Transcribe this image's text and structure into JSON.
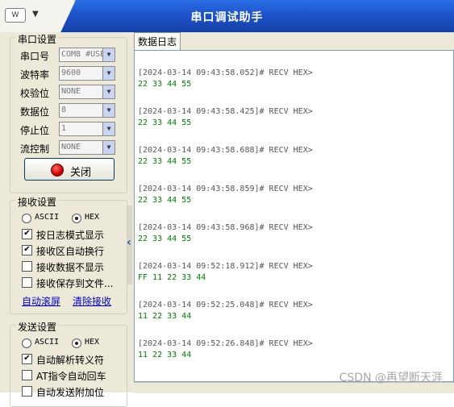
{
  "app": {
    "title": "串口调试助手",
    "logo_text": "W",
    "menu_caret": "▼"
  },
  "serial": {
    "group_label": "串口设置",
    "fields": [
      {
        "label": "串口号",
        "value": "COM8 #USE"
      },
      {
        "label": "波特率",
        "value": "9600"
      },
      {
        "label": "校验位",
        "value": "NONE"
      },
      {
        "label": "数据位",
        "value": "8"
      },
      {
        "label": "停止位",
        "value": "1"
      },
      {
        "label": "流控制",
        "value": "NONE"
      }
    ],
    "close_button": "关闭"
  },
  "receive": {
    "group_label": "接收设置",
    "mode_ascii": "ASCII",
    "mode_hex": "HEX",
    "options": [
      {
        "label": "按日志模式显示",
        "checked": true
      },
      {
        "label": "接收区自动换行",
        "checked": true
      },
      {
        "label": "接收数据不显示",
        "checked": false
      },
      {
        "label": "接收保存到文件...",
        "checked": false
      }
    ],
    "auto_scroll": "自动滚屏",
    "clear_receive": "清除接收"
  },
  "send": {
    "group_label": "发送设置",
    "mode_ascii": "ASCII",
    "mode_hex": "HEX",
    "options": [
      {
        "label": "自动解析转义符",
        "checked": true
      },
      {
        "label": "AT指令自动回车",
        "checked": false
      },
      {
        "label": "自动发送附加位",
        "checked": false
      }
    ]
  },
  "log": {
    "tab_label": "数据日志",
    "entries": [
      {
        "header": "[2024-03-14 09:43:58.052]# RECV HEX>",
        "data": "22 33 44 55"
      },
      {
        "header": "[2024-03-14 09:43:58.425]# RECV HEX>",
        "data": "22 33 44 55"
      },
      {
        "header": "[2024-03-14 09:43:58.688]# RECV HEX>",
        "data": "22 33 44 55"
      },
      {
        "header": "[2024-03-14 09:43:58.859]# RECV HEX>",
        "data": "22 33 44 55"
      },
      {
        "header": "[2024-03-14 09:43:58.968]# RECV HEX>",
        "data": "22 33 44 55"
      },
      {
        "header": "[2024-03-14 09:52:18.912]# RECV HEX>",
        "data": "FF 11 22 33 44"
      },
      {
        "header": "[2024-03-14 09:52:25.048]# RECV HEX>",
        "data": "11 22 33 44"
      },
      {
        "header": "[2024-03-14 09:52:26.848]# RECV HEX>",
        "data": "11 22 33 44"
      }
    ]
  },
  "watermark": "CSDN @再望断天涯",
  "colors": {
    "titlebar": "#1b4fc4",
    "log_data": "#008000",
    "link": "#0000cc"
  }
}
